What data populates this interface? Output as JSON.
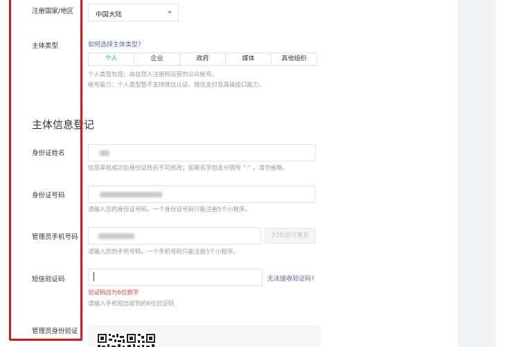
{
  "form": {
    "region": {
      "label": "注册国家/地区",
      "value": "中国大陆"
    },
    "subject_type": {
      "label": "主体类型",
      "help_link": "如何选择主体类型?",
      "options": [
        "个人",
        "企业",
        "政府",
        "媒体",
        "其他组织"
      ],
      "selected": "个人",
      "tip_line1": "个人类型包括：由自然人注册和运营的公众帐号。",
      "tip_line2": "帐号能力：个人类型暂不支持微信认证、微信支付及高级接口能力。"
    },
    "section_title": "主体信息登记",
    "id_name": {
      "label": "身份证姓名",
      "tip": "信息审核成功后身份证姓名不可修改；如果名字包含分隔号 “·” ，请勿省略。"
    },
    "id_number": {
      "label": "身份证号码",
      "tip": "请输入您的身份证号码。一个身份证号码只能注册5个小程序。"
    },
    "admin_phone": {
      "label": "管理员手机号码",
      "resend_button": "53秒后可重发",
      "tip": "请输入您的手机号码，一个手机号码只能注册5个小程序。"
    },
    "sms_code": {
      "label": "短信验证码",
      "help_link": "无法接收验证码?",
      "error": "验证码应为6位数字",
      "tip": "请输入手机短信收到的6位验证码"
    },
    "admin_verify": {
      "label": "管理员身份验证"
    }
  },
  "colors": {
    "highlight_box": "#e0141e",
    "link": "#576b95",
    "error": "#e64340",
    "selected": "#07c160"
  }
}
